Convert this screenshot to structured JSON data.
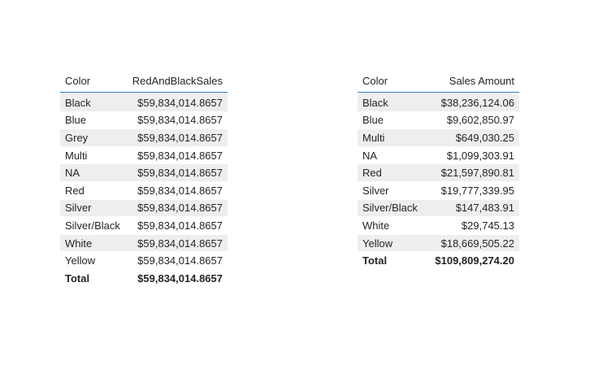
{
  "left_table": {
    "headers": [
      "Color",
      "RedAndBlackSales"
    ],
    "rows": [
      [
        "Black",
        "$59,834,014.8657"
      ],
      [
        "Blue",
        "$59,834,014.8657"
      ],
      [
        "Grey",
        "$59,834,014.8657"
      ],
      [
        "Multi",
        "$59,834,014.8657"
      ],
      [
        "NA",
        "$59,834,014.8657"
      ],
      [
        "Red",
        "$59,834,014.8657"
      ],
      [
        "Silver",
        "$59,834,014.8657"
      ],
      [
        "Silver/Black",
        "$59,834,014.8657"
      ],
      [
        "White",
        "$59,834,014.8657"
      ],
      [
        "Yellow",
        "$59,834,014.8657"
      ]
    ],
    "total": [
      "Total",
      "$59,834,014.8657"
    ]
  },
  "right_table": {
    "headers": [
      "Color",
      "Sales Amount"
    ],
    "rows": [
      [
        "Black",
        "$38,236,124.06"
      ],
      [
        "Blue",
        "$9,602,850.97"
      ],
      [
        "Multi",
        "$649,030.25"
      ],
      [
        "NA",
        "$1,099,303.91"
      ],
      [
        "Red",
        "$21,597,890.81"
      ],
      [
        "Silver",
        "$19,777,339.95"
      ],
      [
        "Silver/Black",
        "$147,483.91"
      ],
      [
        "White",
        "$29,745.13"
      ],
      [
        "Yellow",
        "$18,669,505.22"
      ]
    ],
    "total": [
      "Total",
      "$109,809,274.20"
    ]
  },
  "colors": {
    "header_rule": "#2b7bbf",
    "stripe": "#eeeeee",
    "text": "#252423"
  }
}
